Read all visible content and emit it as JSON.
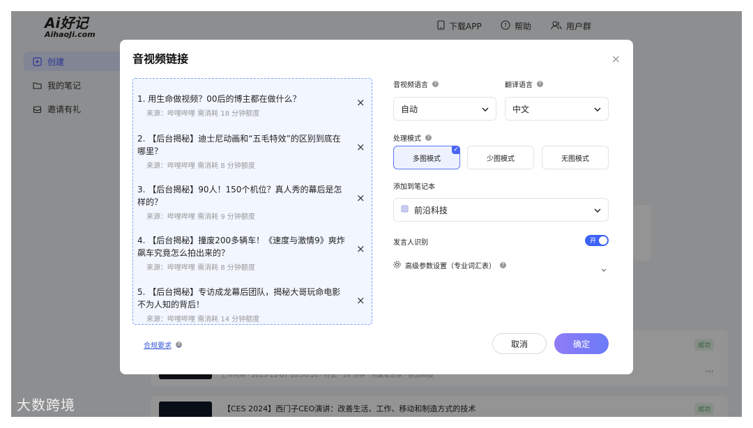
{
  "app": {
    "logo_main": "Ai好记",
    "logo_sub": "AihaoJi.com"
  },
  "sidebar": {
    "items": [
      {
        "label": "创建",
        "icon": "create-icon"
      },
      {
        "label": "我的笔记",
        "icon": "folder-icon"
      },
      {
        "label": "邀请有礼",
        "icon": "gift-icon"
      }
    ]
  },
  "topbar": {
    "download": "下载APP",
    "help": "帮助",
    "community": "用户群"
  },
  "background": {
    "badge1": "成功",
    "badge2": "成功",
    "more": "···",
    "row_faded": "上传时间 · 2023-11-07 10:30:10 · 时长 · 39 分钟 · 所属笔记本 · 前沿科技",
    "row2_title": "【CES 2024】西门子CEO演讲：改善生活、工作、移动和制造方式的技术"
  },
  "watermark": "大数跨境",
  "modal": {
    "title": "音视频链接",
    "close": "×",
    "items": [
      {
        "title": "1. 用生命做视频？00后的博主都在做什么？",
        "meta": "来源：哔哩哔哩   需消耗 18 分钟额度"
      },
      {
        "title": "2. 【后台揭秘】迪士尼动画和“五毛特效”的区别到底在哪里？",
        "meta": "来源：哔哩哔哩   需消耗 8 分钟额度"
      },
      {
        "title": "3. 【后台揭秘】90人！150个机位？真人秀的幕后是怎样的？",
        "meta": "来源：哔哩哔哩   需消耗 9 分钟额度"
      },
      {
        "title": "4. 【后台揭秘】撞废200多辆车！《速度与激情9》爽炸飙车究竟怎么拍出来的？",
        "meta": "来源：哔哩哔哩   需消耗 8 分钟额度"
      },
      {
        "title": "5. 【后台揭秘】专访成龙幕后团队，揭秘大哥玩命电影不为人知的背后！",
        "meta": "来源：哔哩哔哩   需消耗 14 分钟额度"
      }
    ],
    "remove_symbol": "×",
    "audio_lang_label": "音视频语言",
    "audio_lang_value": "自动",
    "trans_lang_label": "翻译语言",
    "trans_lang_value": "中文",
    "mode_label": "处理模式",
    "modes": [
      "多图模式",
      "少图模式",
      "无图模式"
    ],
    "notebook_label": "添加到笔记本",
    "notebook_value": "前沿科技",
    "speaker_label": "发言人识别",
    "speaker_toggle": "开",
    "advanced_label": "高级参数设置（专业词汇表）",
    "compliance": "合规要求",
    "cancel": "取消",
    "confirm": "确定",
    "help_mark": "?"
  },
  "colors": {
    "accent": "#4a66f5",
    "confirm_gradient_start": "#8f7bf6",
    "confirm_gradient_end": "#6c7bf8"
  }
}
